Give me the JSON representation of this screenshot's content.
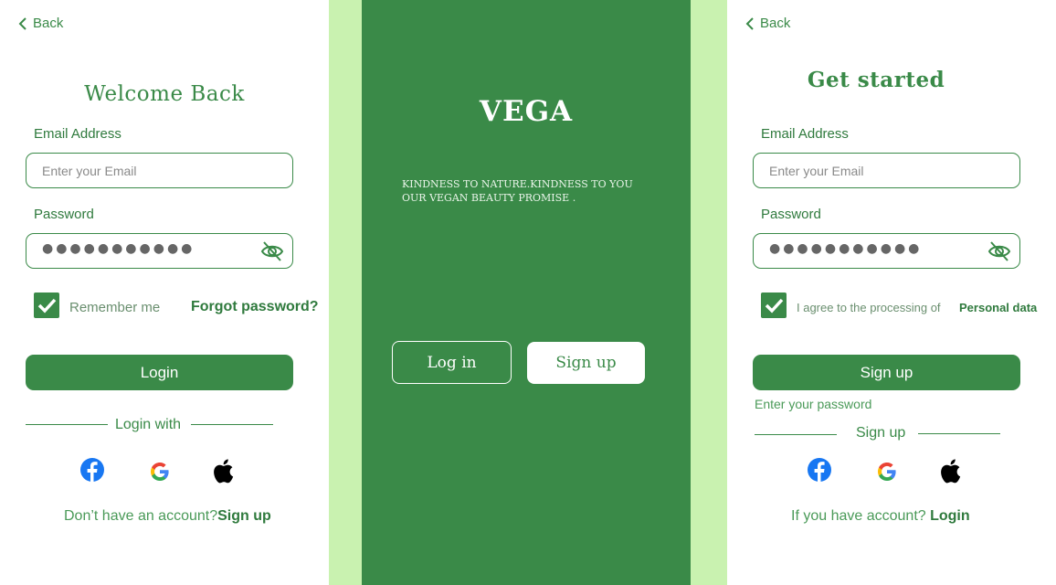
{
  "login_screen": {
    "back_label": "Back",
    "title": "Welcome Back",
    "email_label": "Email Address",
    "email_placeholder": "Enter your Email",
    "password_label": "Password",
    "password_value": "●●●●●●●●●●●",
    "remember_label": "Remember me",
    "remember_checked": true,
    "forgot_label": "Forgot password?",
    "login_button": "Login",
    "divider_text": "Login with",
    "social_icons": [
      "facebook-icon",
      "google-icon",
      "apple-icon"
    ],
    "footer_prefix": "Don’t have an account?",
    "footer_link": "Sign up"
  },
  "splash_screen": {
    "logo": "VEGA",
    "tagline_line1": "KINDNESS TO NATURE.KINDNESS TO YOU",
    "tagline_line2": "OUR VEGAN BEAUTY PROMISE .",
    "login_button": "Log in",
    "signup_button": "Sign up"
  },
  "signup_screen": {
    "back_label": "Back",
    "title": "Get started",
    "email_label": "Email Address",
    "email_placeholder": "Enter your Email",
    "password_label": "Password",
    "password_value": "●●●●●●●●●●●",
    "agree_label": "I agree to the processing of",
    "agree_link": "Personal data",
    "agree_checked": true,
    "signup_button": "Sign up",
    "password_hint": "Enter your password",
    "divider_text": "Sign up",
    "social_icons": [
      "facebook-icon",
      "google-icon",
      "apple-icon"
    ],
    "footer_prefix": "If you have account?",
    "footer_link": "Login"
  },
  "colors": {
    "brand_green": "#3a8a48",
    "light_green_bg": "#c9f2b0",
    "white": "#ffffff"
  }
}
